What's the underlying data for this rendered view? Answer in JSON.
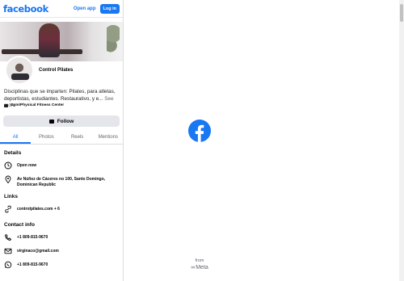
{
  "header": {
    "logo": "facebook",
    "open_app": "Open app",
    "login": "Log in"
  },
  "profile": {
    "name": "Control Pilates",
    "about": "Disciplinas que se imparten: Pilates, para atletas, deportistas, estudiantes. Restaurativo, y e...",
    "see_more": "See more",
    "category": "Gym/Physical Fitness Center",
    "follow": "Follow"
  },
  "tabs": [
    {
      "label": "All",
      "active": true
    },
    {
      "label": "Photos",
      "active": false
    },
    {
      "label": "Reels",
      "active": false
    },
    {
      "label": "Mentions",
      "active": false
    }
  ],
  "details": {
    "title": "Details",
    "hours": "Open now",
    "address": "Av Núñez de Cáceres no 100, Santo Domingo, Dominican Republic"
  },
  "links": {
    "title": "Links",
    "website": "controlpilates.com + 6"
  },
  "contact": {
    "title": "Contact info",
    "phone": "+1 809-815-9670",
    "email": "virginaco@gmail.com",
    "whatsapp": "+1 809-815-9670"
  },
  "splash": {
    "from": "from",
    "meta": "Meta"
  },
  "colors": {
    "brand": "#1877f2",
    "text": "#050505",
    "muted": "#65676b"
  }
}
